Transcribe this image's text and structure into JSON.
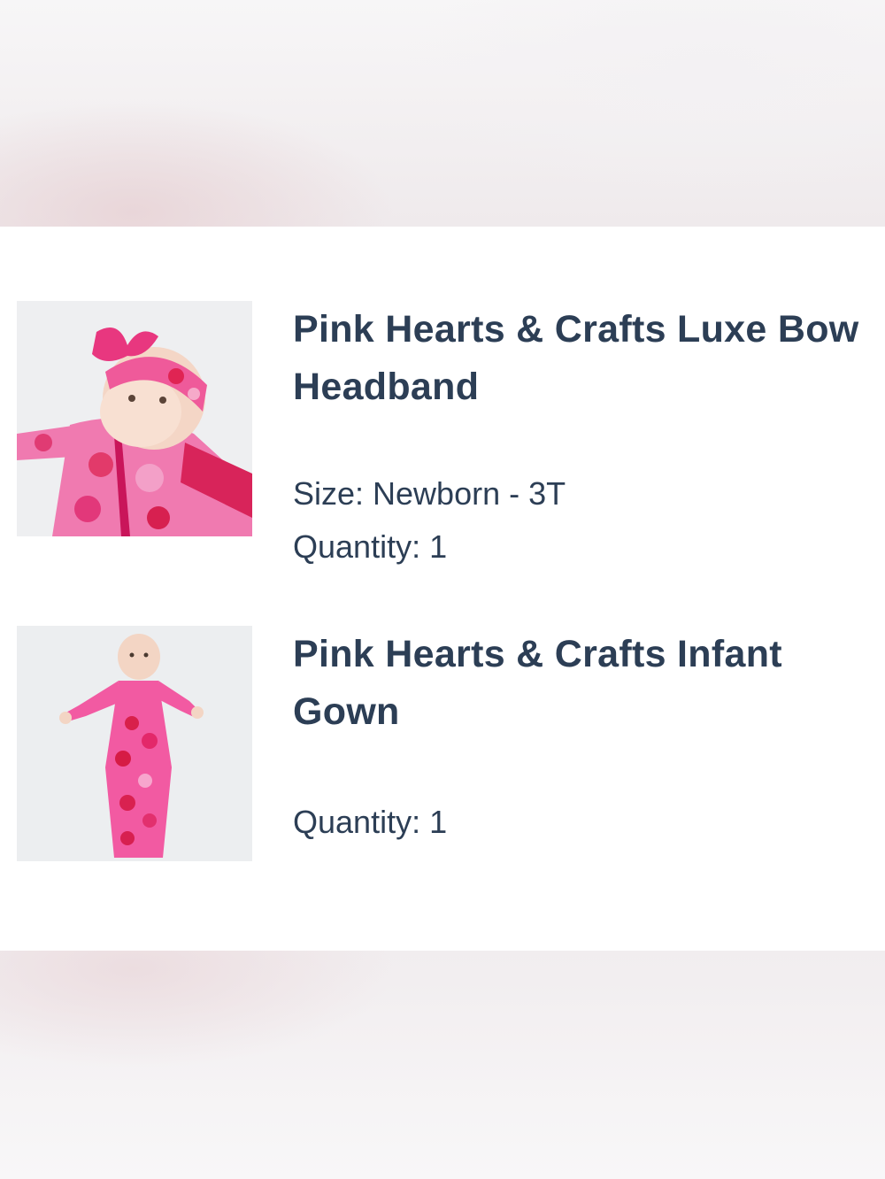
{
  "cart_items": [
    {
      "title": "Pink Hearts & Crafts Luxe Bow Headband",
      "image_alt": "headband-product-image",
      "size_label": "Size: Newborn - 3T",
      "quantity_label": "Quantity: 1"
    },
    {
      "title": "Pink Hearts & Crafts Infant Gown",
      "image_alt": "gown-product-image",
      "quantity_label": "Quantity: 1"
    }
  ],
  "colors": {
    "text": "#2c3e55",
    "card_bg": "#ffffff",
    "pink": "#e8358a",
    "red": "#d9224a"
  }
}
